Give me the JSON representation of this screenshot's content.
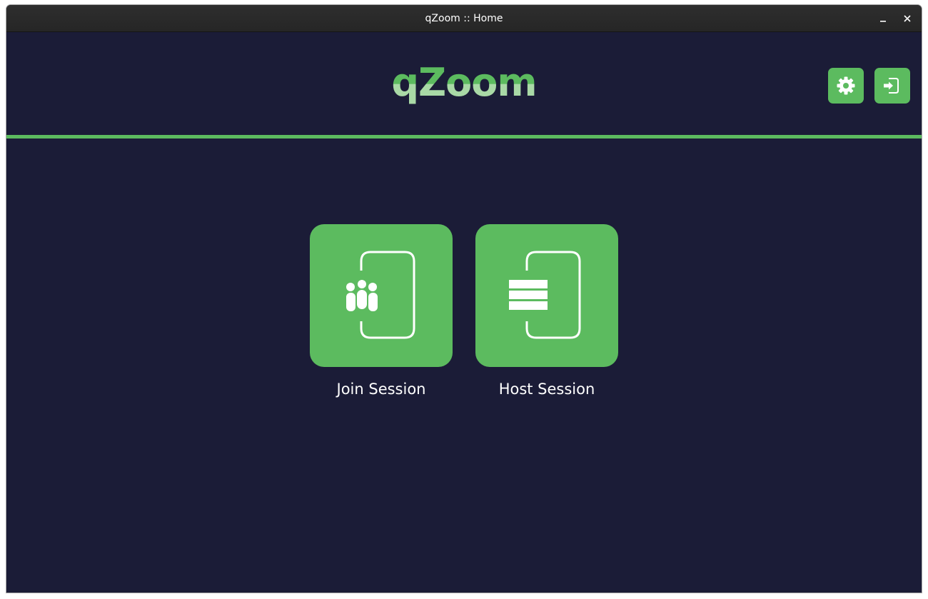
{
  "window": {
    "title": "qZoom :: Home",
    "minimize_icon": "minimize-icon",
    "close_icon": "close-icon"
  },
  "header": {
    "logo": "qZoom",
    "settings_icon": "gear-icon",
    "logout_icon": "logout-icon"
  },
  "actions": [
    {
      "label": "Join Session",
      "icon": "join-session-icon"
    },
    {
      "label": "Host Session",
      "icon": "host-session-icon"
    }
  ],
  "colors": {
    "background": "#1b1c37",
    "accent": "#5cbb5f",
    "titlebar": "#2b2b2b",
    "text": "#ffffff"
  }
}
